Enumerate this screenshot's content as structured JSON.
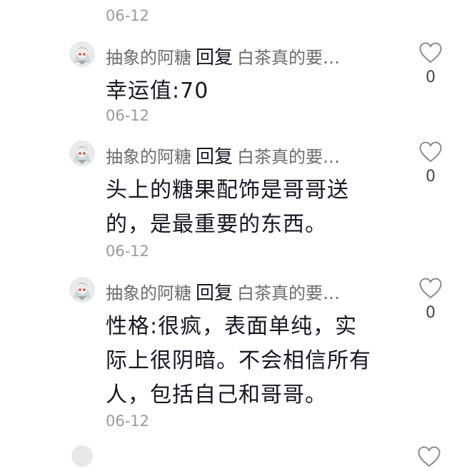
{
  "top_date": "06-12",
  "comments": [
    {
      "author": "抽象的阿糖",
      "reply_word": "回复",
      "reply_target": "白茶真的要…",
      "text": "幸运值:70",
      "date": "06-12",
      "likes": "0"
    },
    {
      "author": "抽象的阿糖",
      "reply_word": "回复",
      "reply_target": "白茶真的要…",
      "text": "头上的糖果配饰是哥哥送的，是最重要的东西。",
      "date": "06-12",
      "likes": "0"
    },
    {
      "author": "抽象的阿糖",
      "reply_word": "回复",
      "reply_target": "白茶真的要…",
      "text": "性格:很疯，表面单纯，实际上很阴暗。不会相信所有人，包括自己和哥哥。",
      "date": "06-12",
      "likes": "0"
    }
  ],
  "icons": {
    "like": "heart-outline-icon",
    "avatar": "user-avatar"
  },
  "colors": {
    "text": "#161823",
    "secondary": "#6b6c72",
    "date": "#9a9aa0"
  }
}
